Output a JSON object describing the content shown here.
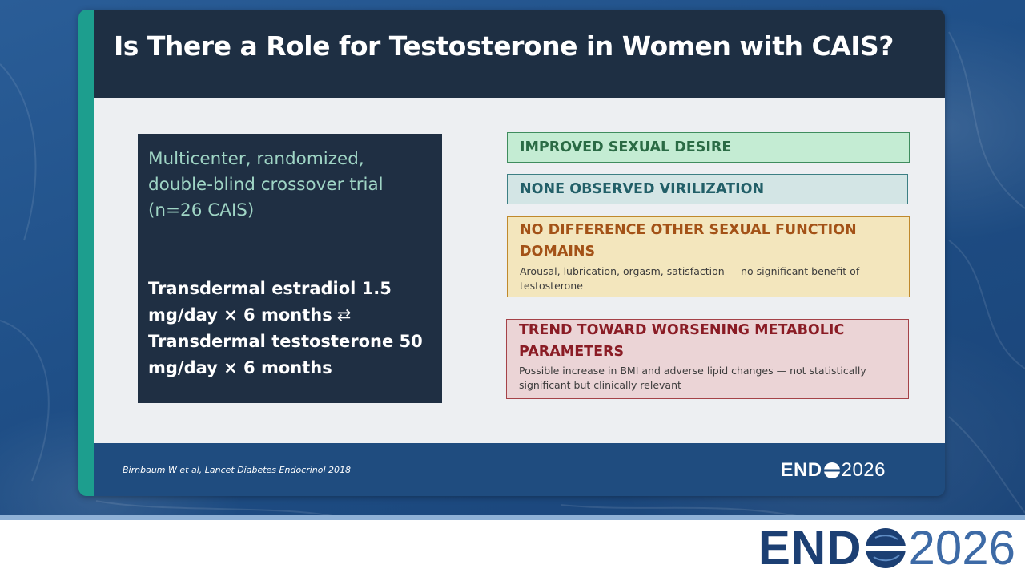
{
  "slide": {
    "title": "Is There a Role for Testosterone in Women with CAIS?",
    "design": {
      "text": "Multicenter, randomized, double-blind crossover trial (n=26 CAIS)",
      "regimen_line1": "Transdermal estradiol 1.5 mg/day × 6 months",
      "swap_symbol": "⇄",
      "regimen_line2": "Transdermal testosterone 50 mg/day × 6 months"
    },
    "findings": [
      {
        "heading": "IMPROVED SEXUAL DESIRE",
        "color": "#2b6b45",
        "background": "#c4ecd3"
      },
      {
        "heading": "NONE OBSERVED VIRILIZATION",
        "color": "#225f68",
        "background": "#d3e5e5"
      },
      {
        "heading": "NO DIFFERENCE OTHER SEXUAL FUNCTION DOMAINS",
        "description": "Arousal, lubrication, orgasm, satisfaction — no significant benefit of testosterone",
        "color": "#a35217",
        "background": "#f3e6bd"
      },
      {
        "heading": "TREND TOWARD WORSENING METABOLIC PARAMETERS",
        "description": "Possible increase in BMI and adverse lipid changes — not statistically significant but clinically relevant",
        "color": "#8a1c25",
        "background": "#ebd4d6"
      }
    ],
    "citation": "Birnbaum W et al, Lancet Diabetes Endocrinol 2018",
    "logo": {
      "end": "END",
      "year": "2026"
    }
  },
  "banner": {
    "logo": {
      "end": "END",
      "year": "2026"
    }
  },
  "colors": {
    "accent": "#1d9e8e",
    "title_bar": "#1e2f43",
    "footer": "#1f4c7f",
    "brand": "#1c3f73"
  }
}
